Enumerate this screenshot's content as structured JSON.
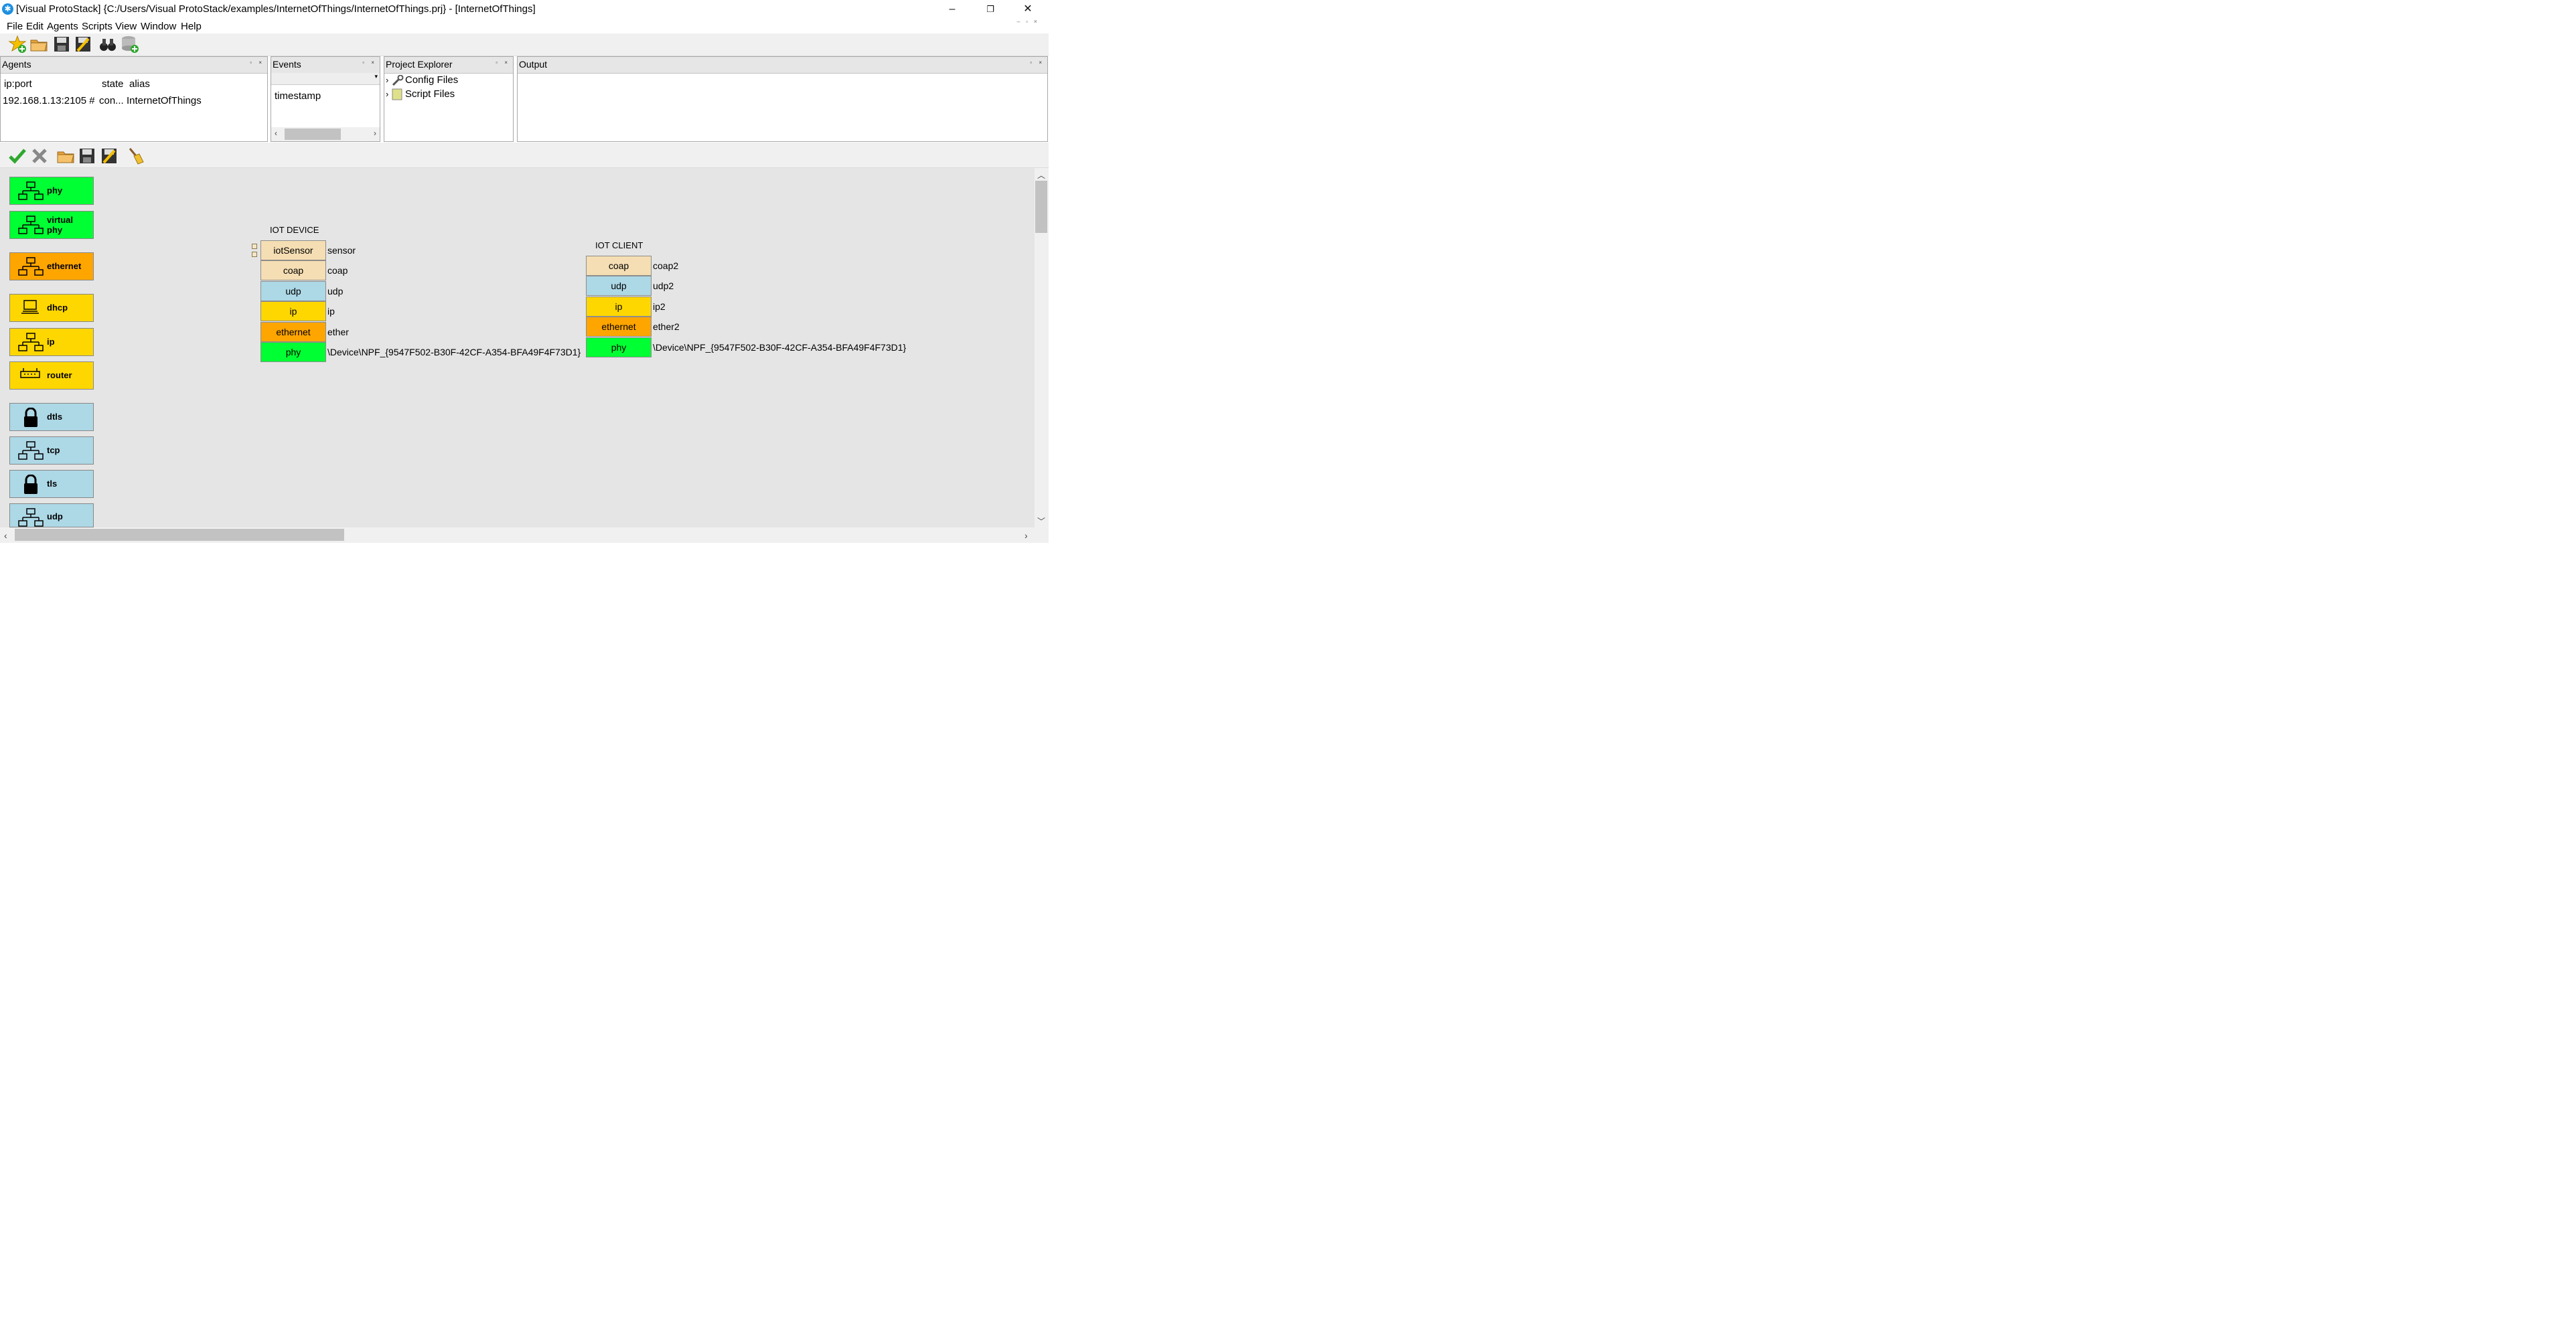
{
  "window": {
    "title": "[Visual ProtoStack] {C:/Users/Visual ProtoStack/examples/InternetOfThings/InternetOfThings.prj} - [InternetOfThings]",
    "minimize": "–",
    "restore": "❐",
    "close": "✕"
  },
  "menu": [
    "File",
    "Edit",
    "Agents",
    "Scripts",
    "View",
    "Window",
    "Help"
  ],
  "toolbar": [
    "new-project",
    "open-folder",
    "save",
    "save-as",
    "find",
    "add-database"
  ],
  "agents": {
    "title": "Agents",
    "columns": [
      "ip:port",
      "state",
      "alias"
    ],
    "rows": [
      [
        "192.168.1.13:2105 #",
        "con...",
        "InternetOfThings"
      ]
    ]
  },
  "events": {
    "title": "Events",
    "column": "timestamp"
  },
  "project_explorer": {
    "title": "Project Explorer",
    "items": [
      "Config Files",
      "Script Files"
    ]
  },
  "output": {
    "title": "Output"
  },
  "toolbar2": [
    "apply",
    "cancel",
    "open",
    "save",
    "save-as",
    "clear"
  ],
  "palette": [
    {
      "label": "phy",
      "color": "#00ff33",
      "icon": "network-icon"
    },
    {
      "label": "virtual\nphy",
      "color": "#00ff33",
      "icon": "network-icon"
    },
    {
      "label": "ethernet",
      "color": "#ffa500",
      "icon": "network-icon"
    },
    {
      "label": "dhcp",
      "color": "#ffd700",
      "icon": "computer-icon"
    },
    {
      "label": "ip",
      "color": "#ffd700",
      "icon": "network-icon"
    },
    {
      "label": "router",
      "color": "#ffd700",
      "icon": "router-icon"
    },
    {
      "label": "dtls",
      "color": "#add8e6",
      "icon": "lock-icon"
    },
    {
      "label": "tcp",
      "color": "#add8e6",
      "icon": "network-icon"
    },
    {
      "label": "tls",
      "color": "#add8e6",
      "icon": "lock-icon"
    },
    {
      "label": "udp",
      "color": "#add8e6",
      "icon": "network-icon"
    }
  ],
  "stacks": [
    {
      "title": "IOT DEVICE",
      "layers": [
        {
          "name": "iotSensor",
          "label": "sensor",
          "color": "#f5deb3"
        },
        {
          "name": "coap",
          "label": "coap",
          "color": "#f5deb3"
        },
        {
          "name": "udp",
          "label": "udp",
          "color": "#add8e6"
        },
        {
          "name": "ip",
          "label": "ip",
          "color": "#ffd700"
        },
        {
          "name": "ethernet",
          "label": "ether",
          "color": "#ffa500"
        },
        {
          "name": "phy",
          "label": "\\Device\\NPF_{9547F502-B30F-42CF-A354-BFA49F4F73D1}",
          "color": "#00ff33"
        }
      ]
    },
    {
      "title": "IOT CLIENT",
      "layers": [
        {
          "name": "coap",
          "label": "coap2",
          "color": "#f5deb3"
        },
        {
          "name": "udp",
          "label": "udp2",
          "color": "#add8e6"
        },
        {
          "name": "ip",
          "label": "ip2",
          "color": "#ffd700"
        },
        {
          "name": "ethernet",
          "label": "ether2",
          "color": "#ffa500"
        },
        {
          "name": "phy",
          "label": "\\Device\\NPF_{9547F502-B30F-42CF-A354-BFA49F4F73D1}",
          "color": "#00ff33"
        }
      ]
    }
  ]
}
